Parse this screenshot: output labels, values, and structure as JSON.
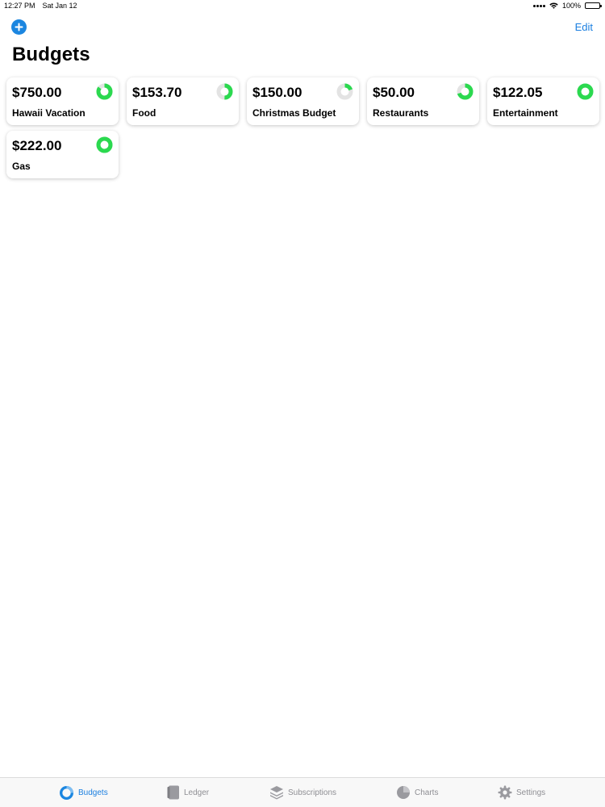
{
  "status_bar": {
    "time": "12:27 PM",
    "date": "Sat Jan 12",
    "battery": "100%"
  },
  "nav": {
    "edit_label": "Edit",
    "title": "Budgets"
  },
  "colors": {
    "accent": "#1b86e0",
    "ring_green": "#2bd94f",
    "ring_track": "#e3e3e3",
    "tab_inactive": "#8e8e93"
  },
  "budgets": [
    {
      "amount": "$750.00",
      "name": "Hawaii Vacation",
      "remaining_fraction": 0.85
    },
    {
      "amount": "$153.70",
      "name": "Food",
      "remaining_fraction": 0.5
    },
    {
      "amount": "$150.00",
      "name": "Christmas Budget",
      "remaining_fraction": 0.2
    },
    {
      "amount": "$50.00",
      "name": "Restaurants",
      "remaining_fraction": 0.7
    },
    {
      "amount": "$122.05",
      "name": "Entertainment",
      "remaining_fraction": 1.0
    },
    {
      "amount": "$222.00",
      "name": "Gas",
      "remaining_fraction": 1.0
    }
  ],
  "tabs": [
    {
      "label": "Budgets",
      "icon": "budgets-icon",
      "active": true
    },
    {
      "label": "Ledger",
      "icon": "ledger-icon",
      "active": false
    },
    {
      "label": "Subscriptions",
      "icon": "subscriptions-icon",
      "active": false
    },
    {
      "label": "Charts",
      "icon": "charts-icon",
      "active": false
    },
    {
      "label": "Settings",
      "icon": "settings-icon",
      "active": false
    }
  ]
}
